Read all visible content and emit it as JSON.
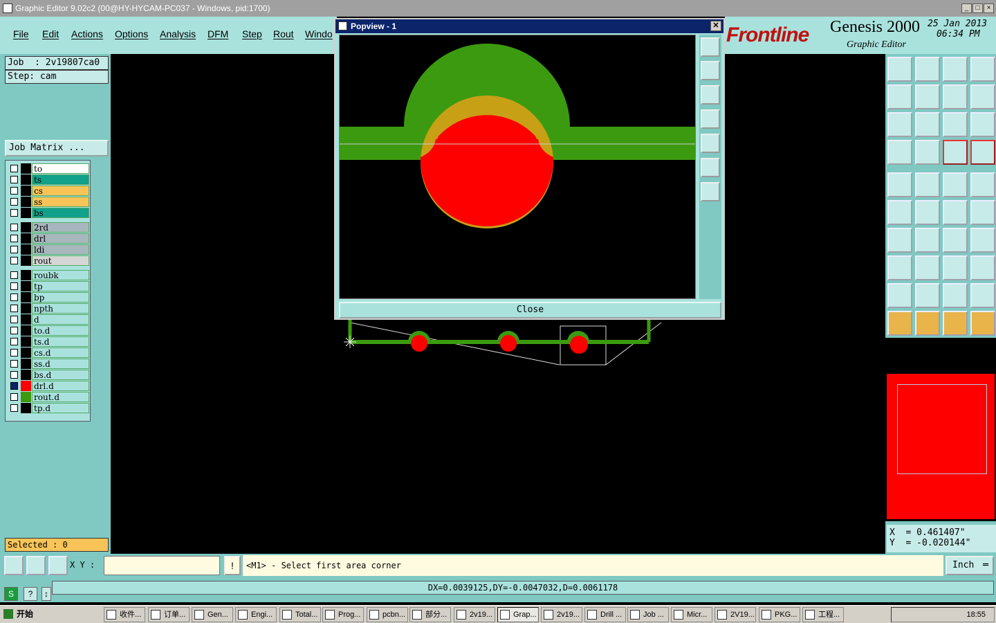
{
  "window": {
    "title": "Graphic Editor 9.02c2 (00@HY-HYCAM-PC037 - Windows, pid:1700)",
    "controls": [
      "_",
      "□",
      "×"
    ]
  },
  "menu": [
    "File",
    "Edit",
    "Actions",
    "Options",
    "Analysis",
    "DFM",
    "Step",
    "Rout",
    "Windo"
  ],
  "logo": {
    "brand": "Frontline",
    "product": "Genesis 2000",
    "subtitle": "Graphic Editor",
    "date": "25 Jan 2013",
    "time": "06:34 PM"
  },
  "job": {
    "job_label": "Job  : 2v19807ca0",
    "step_label": "Step: cam",
    "matrix_button": "Job Matrix ..."
  },
  "layers": [
    {
      "name": "to",
      "color": "#ffffff",
      "swatch": "#000000"
    },
    {
      "name": "ts",
      "color": "#11a08a",
      "swatch": "#000000"
    },
    {
      "name": "cs",
      "color": "#f8c458",
      "swatch": "#000000"
    },
    {
      "name": "ss",
      "color": "#f8c458",
      "swatch": "#000000"
    },
    {
      "name": "bs",
      "color": "#11a08a",
      "swatch": "#000000"
    },
    {
      "name": "2rd",
      "color": "#a8b7bd",
      "swatch": "#000000"
    },
    {
      "name": "drl",
      "color": "#a8b7bd",
      "swatch": "#000000"
    },
    {
      "name": "ldi",
      "color": "#a8b7bd",
      "swatch": "#000000"
    },
    {
      "name": "rout",
      "color": "#d6d6d6",
      "swatch": "#000000"
    },
    {
      "name": "roubk",
      "color": "#a9e2dd",
      "swatch": "#000000"
    },
    {
      "name": "tp",
      "color": "#a9e2dd",
      "swatch": "#000000"
    },
    {
      "name": "bp",
      "color": "#a9e2dd",
      "swatch": "#000000"
    },
    {
      "name": "npth",
      "color": "#a9e2dd",
      "swatch": "#000000"
    },
    {
      "name": "d",
      "color": "#a9e2dd",
      "swatch": "#000000"
    },
    {
      "name": "to.d",
      "color": "#a9e2dd",
      "swatch": "#000000"
    },
    {
      "name": "ts.d",
      "color": "#a9e2dd",
      "swatch": "#000000"
    },
    {
      "name": "cs.d",
      "color": "#a9e2dd",
      "swatch": "#000000"
    },
    {
      "name": "ss.d",
      "color": "#a9e2dd",
      "swatch": "#000000"
    },
    {
      "name": "bs.d",
      "color": "#a9e2dd",
      "swatch": "#000000"
    },
    {
      "name": "drl.d",
      "color": "#a9e2dd",
      "swatch": "#ff0000"
    },
    {
      "name": "rout.d",
      "color": "#a9e2dd",
      "swatch": "#3c9a10"
    },
    {
      "name": "tp.d",
      "color": "#a9e2dd",
      "swatch": "#000000"
    }
  ],
  "selected_label": "Selected : 0",
  "popview": {
    "title": "Popview - 1",
    "close_label": "Close"
  },
  "command": {
    "xy_label": "X Y :",
    "xy_value": "",
    "bang": "!",
    "message": "<M1> - Select first area corner",
    "unit": "Inch"
  },
  "coords": {
    "x": "X  = 0.461407\"",
    "y": "Y  = -0.020144\""
  },
  "status": "DX=0.0039125,DY=-0.0047032,D=0.0061178",
  "taskbar": {
    "start": "开始",
    "tasks": [
      "收件...",
      "订单...",
      "Gen...",
      "Engi...",
      "Total...",
      "Prog...",
      "pcbn...",
      "部分...",
      "2v19...",
      "Grap...",
      "2v19...",
      "Drill ...",
      "Job ...",
      "Micr...",
      "2V19...",
      "PKG...",
      "工程..."
    ],
    "clock": "18:55"
  },
  "colors": {
    "panel": "#7fc9c2",
    "panel_light": "#a9e2dd",
    "copper_green": "#3c9a10",
    "drill_red": "#ff0000",
    "overlap_gold": "#c8a016"
  }
}
